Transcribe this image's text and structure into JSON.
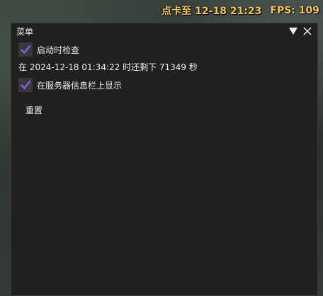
{
  "hud": {
    "checkin_label": "点卡至 12-18 21:23",
    "fps_label": "FPS: 109"
  },
  "window": {
    "title": "菜单",
    "collapse_icon": "triangle-down-icon",
    "close_icon": "close-icon"
  },
  "options": {
    "check_on_start": {
      "label": "启动时检查",
      "checked": true
    },
    "status_text": "在 2024-12-18 01:34:22 时还剩下 71349 秒",
    "show_in_server_bar": {
      "label": "在服务器信息栏上显示",
      "checked": true
    },
    "reset_label": "重置"
  },
  "colors": {
    "hud_text": "#f2c45a",
    "checkmark": "#8a5fe0",
    "window_bg": "#202020"
  }
}
